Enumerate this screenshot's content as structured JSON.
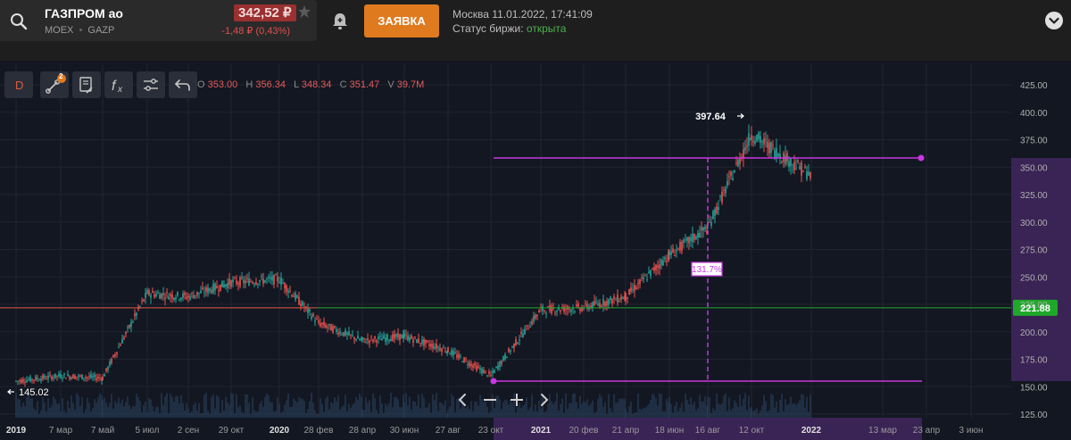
{
  "ticker": {
    "name": "ГАЗПРОМ ао",
    "exchange": "MOEX",
    "code": "GAZP",
    "price": "342,52 ₽",
    "change": "-1,48 ₽ (0,43%)"
  },
  "order_button": "ЗАЯВКА",
  "clock": "Москва 11.01.2022, 17:41:09",
  "exchange_status": {
    "label": "Статус биржи: ",
    "value": "открыта"
  },
  "toolbar": {
    "interval": "D",
    "badge": "2",
    "buttons": [
      "drawing-tools-icon",
      "indicators-icon",
      "formula-icon",
      "settings-icon",
      "undo-icon"
    ]
  },
  "ohlc": {
    "o_label": "O",
    "o": "353.00",
    "h_label": "H",
    "h": "356.34",
    "l_label": "L",
    "l": "348.34",
    "c_label": "C",
    "c": "351.47",
    "v_label": "V",
    "v": "39.7M"
  },
  "annotations": {
    "high": "397.64",
    "low": "145.02",
    "range_pct": "131.7%",
    "current_price": "221.88"
  },
  "colors": {
    "up": "#26a69a",
    "down": "#ef5350",
    "accent": "#e07a1f",
    "measure": "#c837e0",
    "price_line": "#e04040",
    "current_line": "#1fa82a"
  },
  "chart_data": {
    "type": "line",
    "title": "",
    "y_axis": {
      "range": [
        125,
        425
      ],
      "ticks": [
        "425.00",
        "400.00",
        "375.00",
        "350.00",
        "325.00",
        "300.00",
        "275.00",
        "250.00",
        "225.00",
        "200.00",
        "175.00",
        "150.00",
        "125.00"
      ]
    },
    "x_axis": {
      "ticks": [
        "2019",
        "7 мар",
        "7 май",
        "5 июл",
        "2 сен",
        "29 окт",
        "2020",
        "28 фев",
        "28 апр",
        "30 июн",
        "27 авг",
        "23 окт",
        "2021",
        "20 фев",
        "21 апр",
        "18 июн",
        "16 авг",
        "12 окт",
        "2022",
        "13 мар",
        "23 апр",
        "3 июн"
      ]
    },
    "series": [
      {
        "values": [
          {
            "x": "2019",
            "y": 155
          },
          {
            "x": "7 мар",
            "y": 160
          },
          {
            "x": "7 май",
            "y": 158
          },
          {
            "x": "5 июл",
            "y": 235
          },
          {
            "x": "2 сен",
            "y": 232
          },
          {
            "x": "29 окт",
            "y": 245
          },
          {
            "x": "2020",
            "y": 248
          },
          {
            "x": "28 фев",
            "y": 208
          },
          {
            "x": "28 апр",
            "y": 192
          },
          {
            "x": "30 июн",
            "y": 196
          },
          {
            "x": "27 авг",
            "y": 183
          },
          {
            "x": "23 окт",
            "y": 160
          },
          {
            "x": "2021",
            "y": 220
          },
          {
            "x": "20 фев",
            "y": 222
          },
          {
            "x": "21 апр",
            "y": 232
          },
          {
            "x": "18 июн",
            "y": 270
          },
          {
            "x": "16 авг",
            "y": 295
          },
          {
            "x": "12 окт",
            "y": 380
          },
          {
            "x": "2022",
            "y": 342
          }
        ]
      }
    ],
    "high": 397.64,
    "low": 145.02,
    "current": 221.88
  }
}
